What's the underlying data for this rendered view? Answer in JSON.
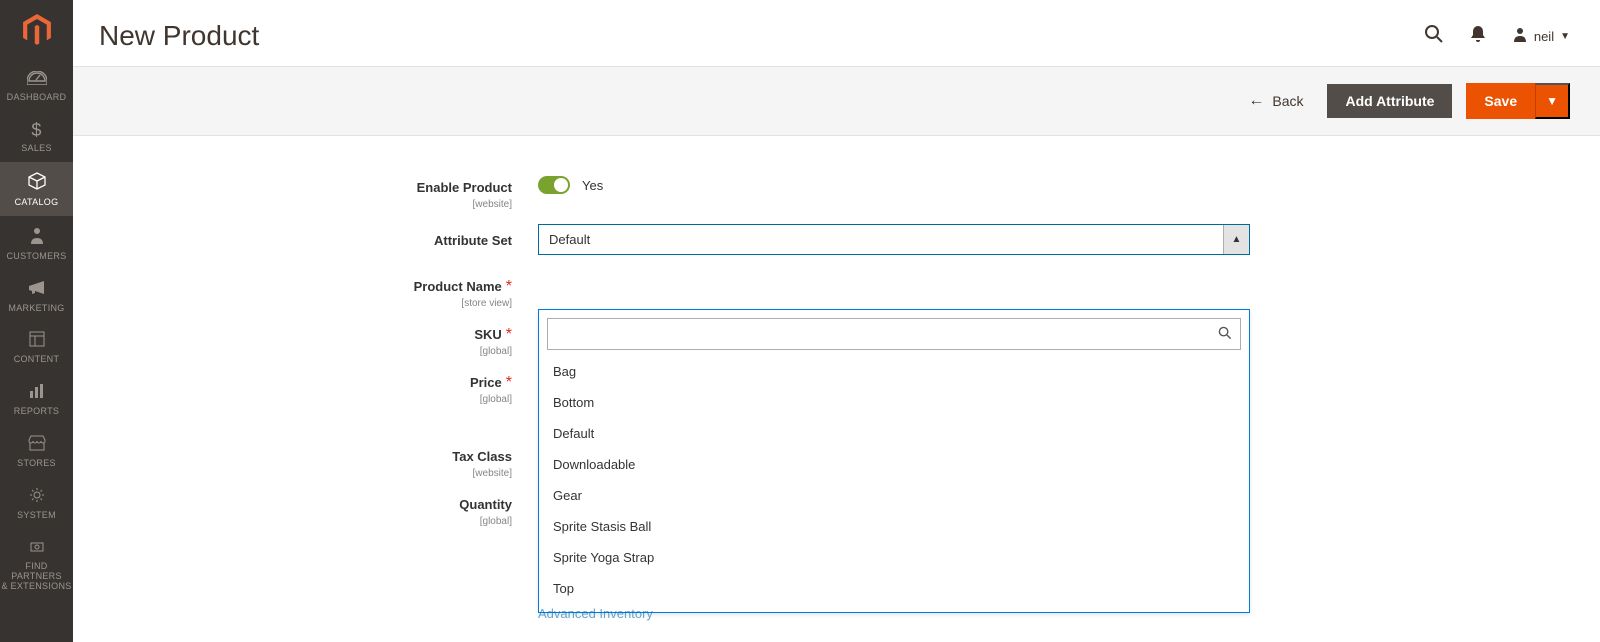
{
  "sidebar": {
    "items": [
      {
        "label": "DASHBOARD"
      },
      {
        "label": "SALES"
      },
      {
        "label": "CATALOG"
      },
      {
        "label": "CUSTOMERS"
      },
      {
        "label": "MARKETING"
      },
      {
        "label": "CONTENT"
      },
      {
        "label": "REPORTS"
      },
      {
        "label": "STORES"
      },
      {
        "label": "SYSTEM"
      },
      {
        "label": "FIND PARTNERS\n& EXTENSIONS"
      }
    ]
  },
  "header": {
    "title": "New Product",
    "user_name": "neil"
  },
  "toolbar": {
    "back_label": "Back",
    "add_attribute_label": "Add Attribute",
    "save_label": "Save"
  },
  "form": {
    "enable_product": {
      "label": "Enable Product",
      "scope": "[website]",
      "value_label": "Yes"
    },
    "attribute_set": {
      "label": "Attribute Set",
      "value": "Default"
    },
    "product_name": {
      "label": "Product Name",
      "scope": "[store view]"
    },
    "sku": {
      "label": "SKU",
      "scope": "[global]"
    },
    "price": {
      "label": "Price",
      "scope": "[global]"
    },
    "tax_class": {
      "label": "Tax Class",
      "scope": "[website]"
    },
    "quantity": {
      "label": "Quantity",
      "scope": "[global]"
    },
    "advanced_inventory_label": "Advanced Inventory"
  },
  "dropdown": {
    "options": [
      "Bag",
      "Bottom",
      "Default",
      "Downloadable",
      "Gear",
      "Sprite Stasis Ball",
      "Sprite Yoga Strap",
      "Top"
    ]
  }
}
